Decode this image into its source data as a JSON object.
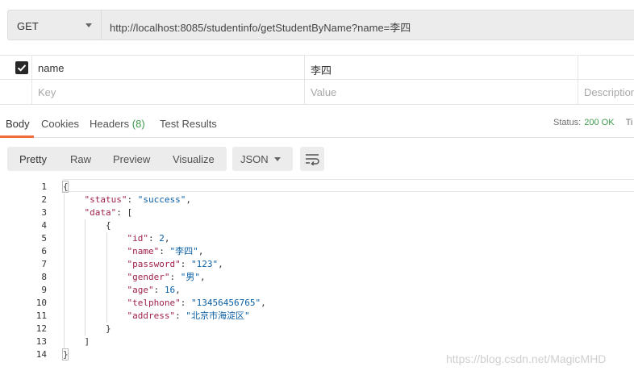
{
  "request": {
    "method": "GET",
    "url": "http://localhost:8085/studentinfo/getStudentByName?name=李四"
  },
  "params": {
    "rows": [
      {
        "checked": true,
        "key": "name",
        "value": "李四",
        "description": ""
      }
    ],
    "placeholders": {
      "key": "Key",
      "value": "Value",
      "description": "Description"
    }
  },
  "response_tabs": {
    "body": "Body",
    "cookies": "Cookies",
    "headers": "Headers",
    "headers_count": "(8)",
    "test_results": "Test Results"
  },
  "status": {
    "label": "Status:",
    "value": "200 OK",
    "more": "Ti"
  },
  "view_modes": [
    "Pretty",
    "Raw",
    "Preview",
    "Visualize"
  ],
  "format": "JSON",
  "icons": {
    "method_caret": "chevron-down-icon",
    "format_caret": "chevron-down-icon",
    "wrap": "wrap-lines-icon",
    "checkbox": "checkbox-checked-icon"
  },
  "colors": {
    "accent_tab": "#f26b3a",
    "status_ok": "#3c9a4a",
    "json_key": "#a0214f",
    "json_string": "#0b5fa5"
  },
  "code": {
    "line_numbers": [
      "1",
      "2",
      "3",
      "4",
      "5",
      "6",
      "7",
      "8",
      "9",
      "10",
      "11",
      "12",
      "13",
      "14"
    ],
    "lines": [
      [
        {
          "t": "punc",
          "v": "{"
        }
      ],
      [
        {
          "t": "punc",
          "v": "    "
        },
        {
          "t": "key",
          "v": "\"status\""
        },
        {
          "t": "punc",
          "v": ": "
        },
        {
          "t": "str",
          "v": "\"success\""
        },
        {
          "t": "punc",
          "v": ","
        }
      ],
      [
        {
          "t": "punc",
          "v": "    "
        },
        {
          "t": "key",
          "v": "\"data\""
        },
        {
          "t": "punc",
          "v": ": ["
        }
      ],
      [
        {
          "t": "punc",
          "v": "        {"
        }
      ],
      [
        {
          "t": "punc",
          "v": "            "
        },
        {
          "t": "key",
          "v": "\"id\""
        },
        {
          "t": "punc",
          "v": ": "
        },
        {
          "t": "num",
          "v": "2"
        },
        {
          "t": "punc",
          "v": ","
        }
      ],
      [
        {
          "t": "punc",
          "v": "            "
        },
        {
          "t": "key",
          "v": "\"name\""
        },
        {
          "t": "punc",
          "v": ": "
        },
        {
          "t": "str",
          "v": "\"李四\""
        },
        {
          "t": "punc",
          "v": ","
        }
      ],
      [
        {
          "t": "punc",
          "v": "            "
        },
        {
          "t": "key",
          "v": "\"password\""
        },
        {
          "t": "punc",
          "v": ": "
        },
        {
          "t": "str",
          "v": "\"123\""
        },
        {
          "t": "punc",
          "v": ","
        }
      ],
      [
        {
          "t": "punc",
          "v": "            "
        },
        {
          "t": "key",
          "v": "\"gender\""
        },
        {
          "t": "punc",
          "v": ": "
        },
        {
          "t": "str",
          "v": "\"男\""
        },
        {
          "t": "punc",
          "v": ","
        }
      ],
      [
        {
          "t": "punc",
          "v": "            "
        },
        {
          "t": "key",
          "v": "\"age\""
        },
        {
          "t": "punc",
          "v": ": "
        },
        {
          "t": "num",
          "v": "16"
        },
        {
          "t": "punc",
          "v": ","
        }
      ],
      [
        {
          "t": "punc",
          "v": "            "
        },
        {
          "t": "key",
          "v": "\"telphone\""
        },
        {
          "t": "punc",
          "v": ": "
        },
        {
          "t": "str",
          "v": "\"13456456765\""
        },
        {
          "t": "punc",
          "v": ","
        }
      ],
      [
        {
          "t": "punc",
          "v": "            "
        },
        {
          "t": "key",
          "v": "\"address\""
        },
        {
          "t": "punc",
          "v": ": "
        },
        {
          "t": "str",
          "v": "\"北京市海淀区\""
        }
      ],
      [
        {
          "t": "punc",
          "v": "        }"
        }
      ],
      [
        {
          "t": "punc",
          "v": "    ]"
        }
      ],
      [
        {
          "t": "punc",
          "v": "}"
        }
      ]
    ]
  },
  "watermark": "https://blog.csdn.net/MagicMHD"
}
